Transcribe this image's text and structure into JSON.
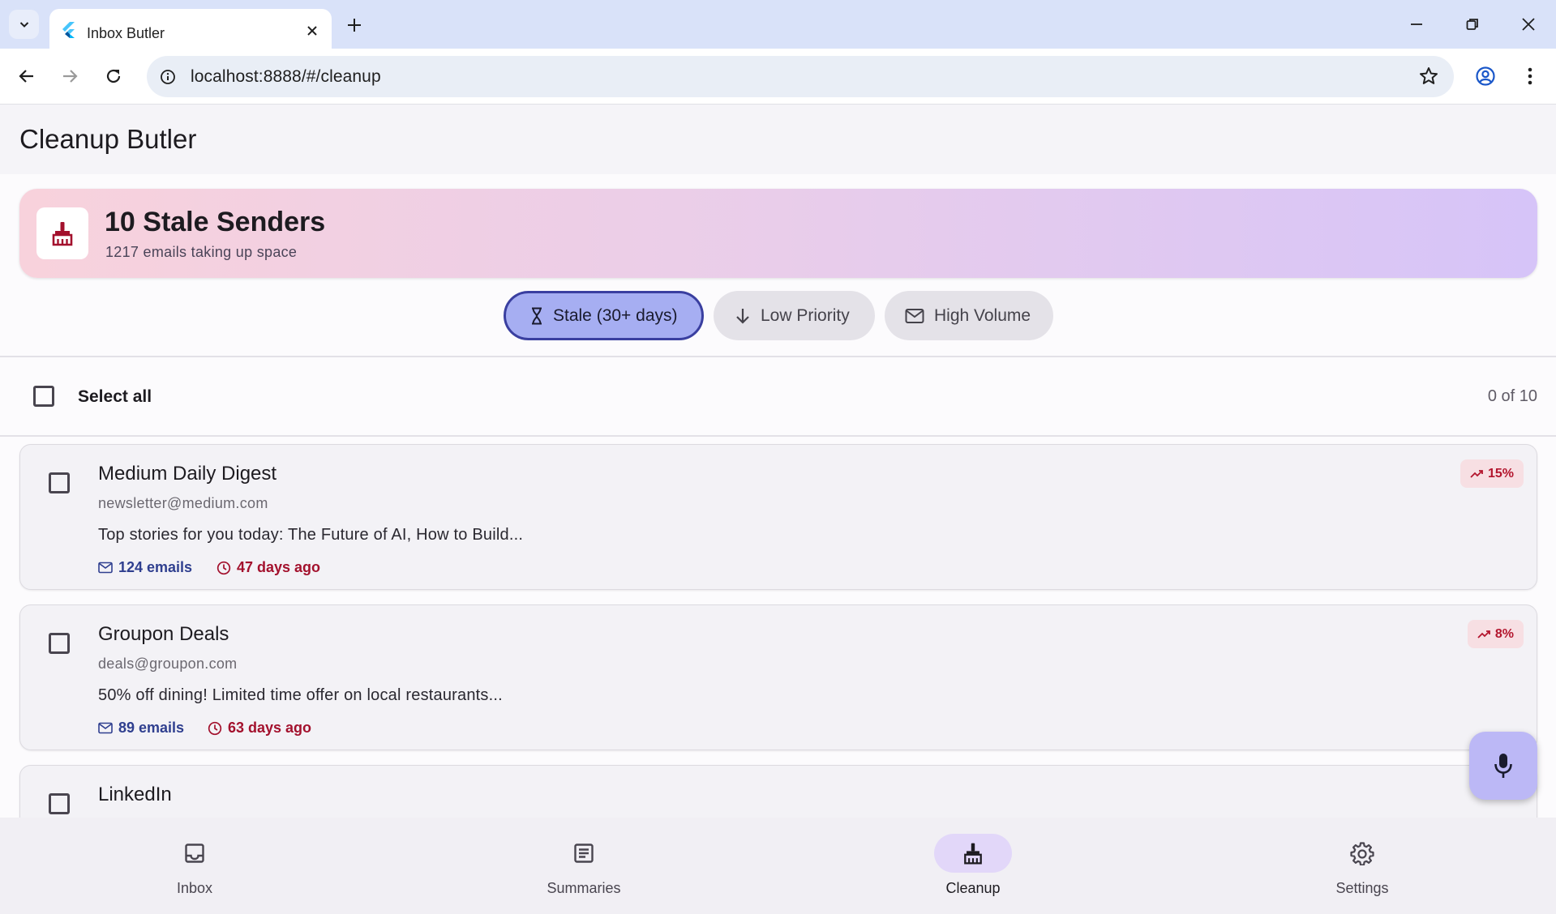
{
  "browser": {
    "tab_title": "Inbox Butler",
    "url": "localhost:8888/#/cleanup"
  },
  "app": {
    "title": "Cleanup Butler"
  },
  "summary": {
    "title": "10 Stale Senders",
    "subtitle": "1217 emails taking up space",
    "icon": "broom-icon",
    "accent": "#a3112d"
  },
  "filters": [
    {
      "label": "Stale (30+ days)",
      "icon": "hourglass-icon",
      "selected": true
    },
    {
      "label": "Low Priority",
      "icon": "arrow-down-icon",
      "selected": false
    },
    {
      "label": "High Volume",
      "icon": "mail-icon",
      "selected": false
    }
  ],
  "selection": {
    "select_all_label": "Select all",
    "count_label": "0 of 10"
  },
  "senders": [
    {
      "name": "Medium Daily Digest",
      "email": "newsletter@medium.com",
      "preview": "Top stories for you today: The Future of AI, How to Build...",
      "email_count": "124 emails",
      "last_seen": "47 days ago",
      "open_rate": "15%"
    },
    {
      "name": "Groupon Deals",
      "email": "deals@groupon.com",
      "preview": "50% off dining! Limited time offer on local restaurants...",
      "email_count": "89 emails",
      "last_seen": "63 days ago",
      "open_rate": "8%"
    },
    {
      "name": "LinkedIn"
    }
  ],
  "bottom_nav": [
    {
      "label": "Inbox",
      "icon": "inbox-icon",
      "active": false
    },
    {
      "label": "Summaries",
      "icon": "article-icon",
      "active": false
    },
    {
      "label": "Cleanup",
      "icon": "broom-icon",
      "active": true
    },
    {
      "label": "Settings",
      "icon": "gear-icon",
      "active": false
    }
  ],
  "colors": {
    "primary": "#3a3fa0",
    "selected_chip": "#a6aef2",
    "stale_red": "#a3112d",
    "count_blue": "#2f3f8f",
    "fab": "#bcb8f6"
  }
}
